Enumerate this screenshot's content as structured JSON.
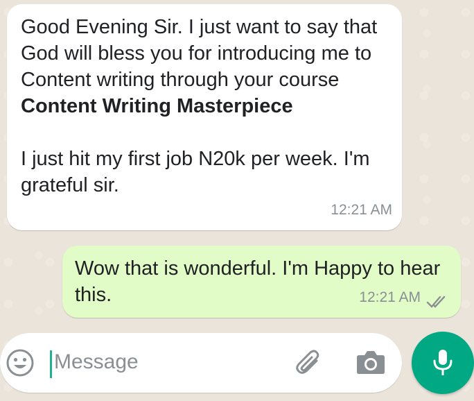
{
  "messages": [
    {
      "direction": "incoming",
      "text_before_bold": "Good Evening Sir. I just want to say that God will bless you for introducing me to Content writing through your course ",
      "text_bold": "Content Writing Masterpiece",
      "text_after_bold": "\n\nI just hit my first job N20k per week. I'm grateful sir.",
      "time": "12:21 AM"
    },
    {
      "direction": "outgoing",
      "text": "Wow that is wonderful. I'm Happy to hear this.",
      "time": "12:21 AM",
      "status_icon": "double-check-icon"
    }
  ],
  "composer": {
    "placeholder": "Message",
    "icons": [
      "emoji-icon",
      "paperclip-icon",
      "camera-icon",
      "microphone-icon"
    ]
  },
  "colors": {
    "incoming_bubble": "#ffffff",
    "outgoing_bubble": "#e2fcc7",
    "accent": "#00a884",
    "timestamp": "#8a8f94"
  }
}
